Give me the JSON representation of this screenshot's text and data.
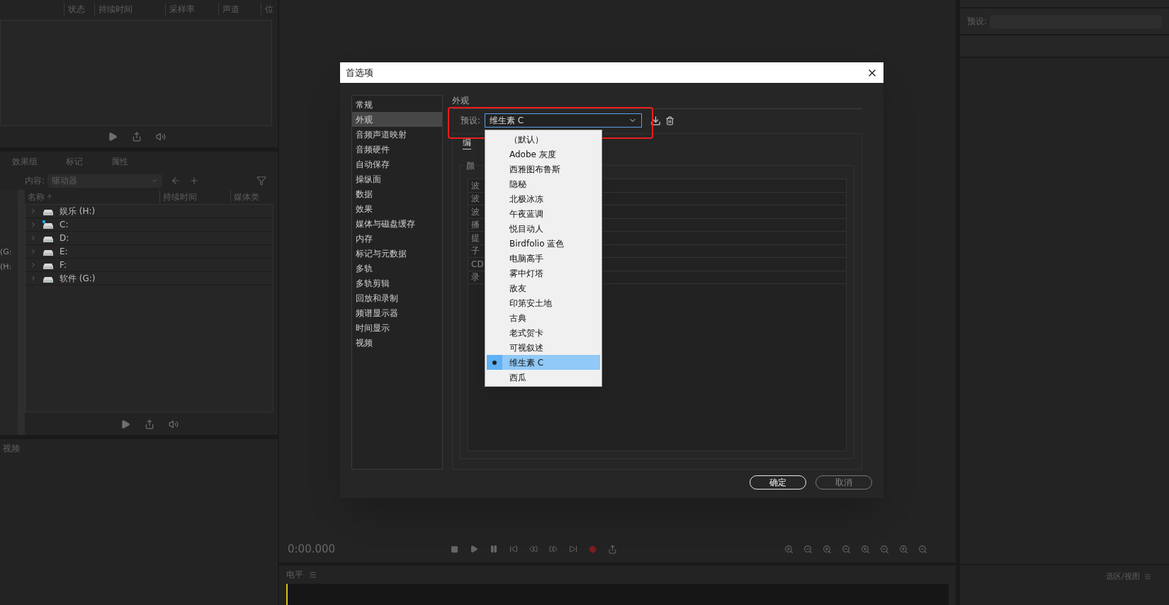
{
  "files_panel": {
    "columns": [
      "状态",
      "持续时间",
      "采样率",
      "声道",
      "位"
    ]
  },
  "media_browser": {
    "tabs": [
      "效果组",
      "标记",
      "属性"
    ],
    "content_label": "内容:",
    "content_value": "驱动器",
    "side_items": [
      "(G:",
      "(H:"
    ],
    "columns": [
      "名称",
      "持续时间",
      "媒体类"
    ],
    "drives": [
      {
        "name": "娱乐 (H:)",
        "kind": "drive"
      },
      {
        "name": "C:",
        "kind": "system"
      },
      {
        "name": "D:",
        "kind": "drive"
      },
      {
        "name": "E:",
        "kind": "drive"
      },
      {
        "name": "F:",
        "kind": "drive"
      },
      {
        "name": "软件 (G:)",
        "kind": "drive"
      }
    ]
  },
  "video_panel": {
    "title": "视频"
  },
  "editor": {
    "time": "0:00.000"
  },
  "level_panel": {
    "title": "电平"
  },
  "selection_panel": {
    "title": "选区/视图"
  },
  "right_panel": {
    "preset_label": "预设:"
  },
  "dialog": {
    "title": "首选项",
    "sidebar": [
      {
        "label": "常规",
        "selected": false
      },
      {
        "label": "外观",
        "selected": true
      },
      {
        "label": "音频声道映射",
        "selected": false
      },
      {
        "label": "音频硬件",
        "selected": false
      },
      {
        "label": "自动保存",
        "selected": false
      },
      {
        "label": "操纵面",
        "selected": false
      },
      {
        "label": "数据",
        "selected": false
      },
      {
        "label": "效果",
        "selected": false
      },
      {
        "label": "媒体与磁盘缓存",
        "selected": false
      },
      {
        "label": "内存",
        "selected": false
      },
      {
        "label": "标记与元数据",
        "selected": false
      },
      {
        "label": "多轨",
        "selected": false
      },
      {
        "label": "多轨剪辑",
        "selected": false
      },
      {
        "label": "回放和录制",
        "selected": false
      },
      {
        "label": "频谱显示器",
        "selected": false
      },
      {
        "label": "时间显示",
        "selected": false
      },
      {
        "label": "视频",
        "selected": false
      }
    ],
    "section": "外观",
    "preset_label": "预设:",
    "preset_value": "维生素 C",
    "tab": "编",
    "group": "颜",
    "rows": [
      "波",
      "波",
      "波",
      "播",
      "提",
      "子",
      "CD",
      "录"
    ],
    "options": [
      {
        "label": "（默认）",
        "selected": false
      },
      {
        "label": "Adobe 灰度",
        "selected": false
      },
      {
        "label": "西雅图布鲁斯",
        "selected": false
      },
      {
        "label": "隐秘",
        "selected": false
      },
      {
        "label": "北极冰冻",
        "selected": false
      },
      {
        "label": "午夜蓝调",
        "selected": false
      },
      {
        "label": "悦目动人",
        "selected": false
      },
      {
        "label": "Birdfolio 蓝色",
        "selected": false
      },
      {
        "label": "电脑高手",
        "selected": false
      },
      {
        "label": "雾中灯塔",
        "selected": false
      },
      {
        "label": "敌友",
        "selected": false
      },
      {
        "label": "印第安土地",
        "selected": false
      },
      {
        "label": "古典",
        "selected": false
      },
      {
        "label": "老式贺卡",
        "selected": false
      },
      {
        "label": "可视叙述",
        "selected": false
      },
      {
        "label": "维生素 C",
        "selected": true
      },
      {
        "label": "西瓜",
        "selected": false
      }
    ],
    "buttons": [
      {
        "label": "确定",
        "kind": "primary"
      },
      {
        "label": "取消",
        "kind": "secondary"
      }
    ]
  }
}
